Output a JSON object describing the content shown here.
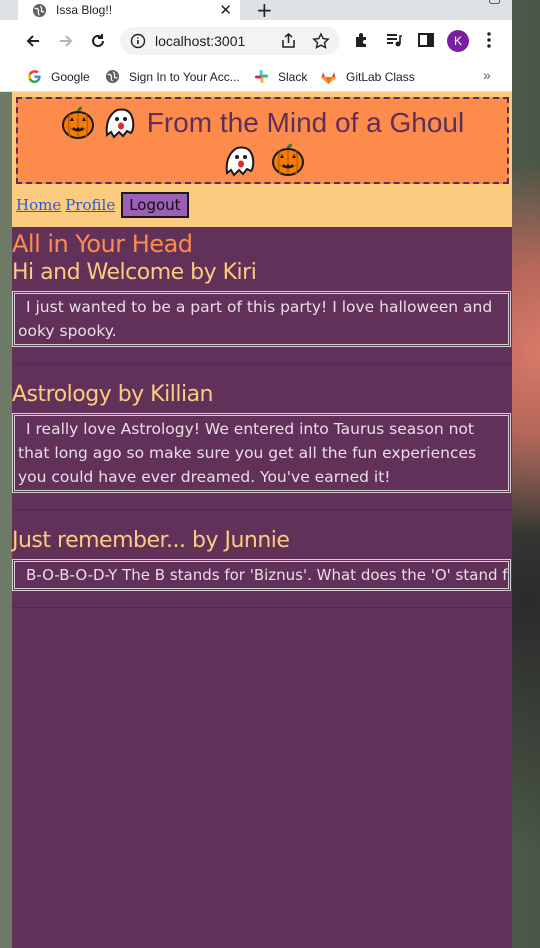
{
  "browser": {
    "tab_title": "Issa Blog!!",
    "url": "localhost:3001",
    "profile_initial": "K",
    "bookmarks": [
      {
        "label": "Google",
        "icon": "google-icon"
      },
      {
        "label": "Sign In to Your Acc...",
        "icon": "globe-icon"
      },
      {
        "label": "Slack",
        "icon": "slack-icon"
      },
      {
        "label": "GitLab Class",
        "icon": "gitlab-icon"
      }
    ]
  },
  "header": {
    "banner_title": "From the Mind of a Ghoul",
    "nav": {
      "home": "Home",
      "profile": "Profile",
      "logout": "Logout"
    }
  },
  "main": {
    "page_title": "All in Your Head",
    "posts": [
      {
        "title": "Hi and Welcome by Kiri",
        "body": "I just wanted to be a part of this party! I love halloween and ooky spooky."
      },
      {
        "title": "Astrology by Killian",
        "body": "I really love Astrology! We entered into Taurus season not that long ago so make sure you get all the fun experiences you could have ever dreamed. You've earned it!"
      },
      {
        "title": "Just remember... by Junnie",
        "body": "B-O-B-O-D-Y The B stands for 'Biznus'. What does the 'O' stand for?"
      }
    ]
  },
  "colors": {
    "page_bg": "#62315a",
    "header_bg": "#fbcb80",
    "banner_bg": "#fd8c4c",
    "title_color": "#fd8c4c",
    "post_title_color": "#fbcb80",
    "logout_bg": "#9b5fb6"
  }
}
